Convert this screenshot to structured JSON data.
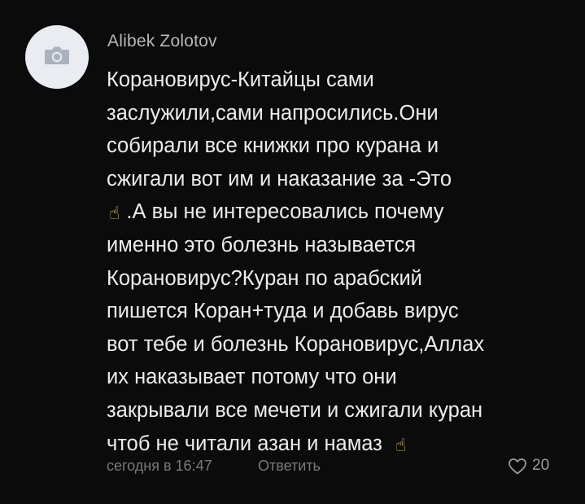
{
  "comment": {
    "author": "Alibek Zolotov",
    "emoji": "☝",
    "lines": [
      "Корановирус-Китайцы сами",
      "заслужили,сами напросились.Они",
      "собирали все книжки про курана и",
      "сжигали вот им и наказание за -Это",
      ".А вы не интересовались почему",
      "именно это болезнь называется",
      "Корановирус?Куран по арабский",
      "пишется Коран+туда и добавь вирус",
      "вот тебе и болезнь Корановирус,Аллах",
      "их наказывает потому что они",
      "закрывали все мечети и сжигали куран",
      "чтоб не читали азан и  намаз"
    ],
    "timestamp": "сегодня в 16:47",
    "reply_label": "Ответить",
    "like_count": "20"
  }
}
